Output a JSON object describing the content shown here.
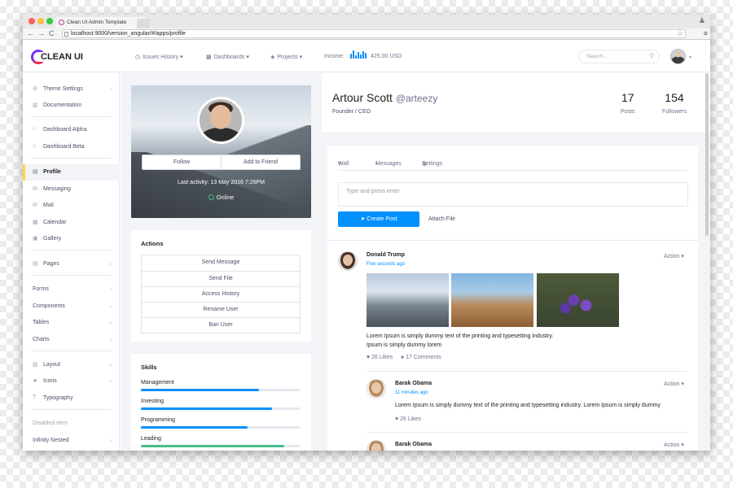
{
  "browser": {
    "tab_title": "Clean UI Admin Template",
    "url": "localhost:9000/version_angular/#/apps/profile"
  },
  "topnav": {
    "logo_text": "CLEAN UI",
    "issues": "Issues History",
    "dashboards": "Dashboards",
    "projects": "Projects",
    "income_label": "Income:",
    "income_value": "425.00 USD",
    "search_placeholder": "Search..."
  },
  "sidebar": {
    "items": [
      {
        "label": "Theme Settings",
        "icon": "gear-icon"
      },
      {
        "label": "Documentation",
        "icon": "book-icon"
      },
      {
        "label": "Dashboard Alpha",
        "icon": "home-icon"
      },
      {
        "label": "Dashboard Beta",
        "icon": "home-icon"
      },
      {
        "label": "Profile",
        "icon": "profile-icon"
      },
      {
        "label": "Messaging",
        "icon": "envelope-icon"
      },
      {
        "label": "Mail",
        "icon": "mail-icon"
      },
      {
        "label": "Calendar",
        "icon": "calendar-icon"
      },
      {
        "label": "Gallery",
        "icon": "image-icon"
      },
      {
        "label": "Pages",
        "icon": "pages-icon"
      },
      {
        "label": "Forms"
      },
      {
        "label": "Components"
      },
      {
        "label": "Tables"
      },
      {
        "label": "Charts"
      },
      {
        "label": "Layout",
        "icon": "layout-icon"
      },
      {
        "label": "Icons",
        "icon": "star-icon"
      },
      {
        "label": "Typography",
        "icon": "typography-icon"
      },
      {
        "label": "Disabled Item"
      },
      {
        "label": "Infinity Nested"
      }
    ]
  },
  "profile": {
    "follow": "Follow",
    "add_friend": "Add to Friend",
    "last_activity": "Last activity: 13 May 2016 7:26PM",
    "status": "Online",
    "name": "Artour Scott",
    "handle": "@arteezy",
    "role": "Founder / CEO",
    "posts_count": "17",
    "posts_label": "Posts",
    "followers_count": "154",
    "followers_label": "Followers"
  },
  "actions": {
    "title": "Actions",
    "items": [
      "Send Message",
      "Send File",
      "Access History",
      "Rename User",
      "Ban User"
    ]
  },
  "skills": {
    "title": "Skills",
    "items": [
      {
        "label": "Management",
        "value": 0.74,
        "color": "#0190fe"
      },
      {
        "label": "Investing",
        "value": 0.82,
        "color": "#0190fe"
      },
      {
        "label": "Programming",
        "value": 0.67,
        "color": "#0190fe"
      },
      {
        "label": "Leading",
        "value": 0.9,
        "color": "#46be8a"
      }
    ]
  },
  "wall": {
    "tabs": [
      "Wall",
      "Messages",
      "Settings"
    ],
    "post_placeholder": "Type and press enter",
    "create_post": "Create Post",
    "attach_file": "Attach File",
    "posts": [
      {
        "author": "Donald Trump",
        "time": "Five seconds ago",
        "action": "Action",
        "text1": "Lorem Ipsum is simply dummy text of the printing and typesetting industry.",
        "text2": "Ipsum is simply dummy lorem",
        "likes": "26 Likes",
        "comments": "17 Comments"
      },
      {
        "author": "Barak Obama",
        "time": "11 minutes ago",
        "action": "Action",
        "text1": "Lorem Ipsum is simply dummy text of the printing and typesetting industry. Lorem Ipsum is simply dummy",
        "likes": "26 Likes"
      },
      {
        "author": "Barak Obama",
        "action": "Action"
      }
    ]
  }
}
